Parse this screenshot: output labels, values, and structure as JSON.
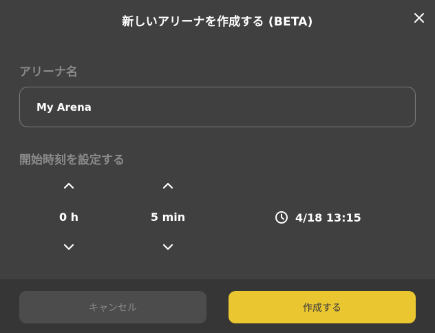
{
  "dialog": {
    "title": "新しいアリーナを作成する (BETA)"
  },
  "name_section": {
    "label": "アリーナ名",
    "value": "My Arena"
  },
  "time_section": {
    "label": "開始時刻を設定する",
    "hours": "0 h",
    "minutes": "5 min",
    "end_time": "4/18 13:15"
  },
  "footer": {
    "cancel_label": "キャンセル",
    "create_label": "作成する"
  },
  "colors": {
    "background": "#404040",
    "footer_background": "#363636",
    "accent": "#eac630",
    "muted_text": "#8a8a8a"
  },
  "icons": {
    "close": "close-icon",
    "up": "chevron-up-icon",
    "down": "chevron-down-icon",
    "clock": "clock-icon"
  }
}
